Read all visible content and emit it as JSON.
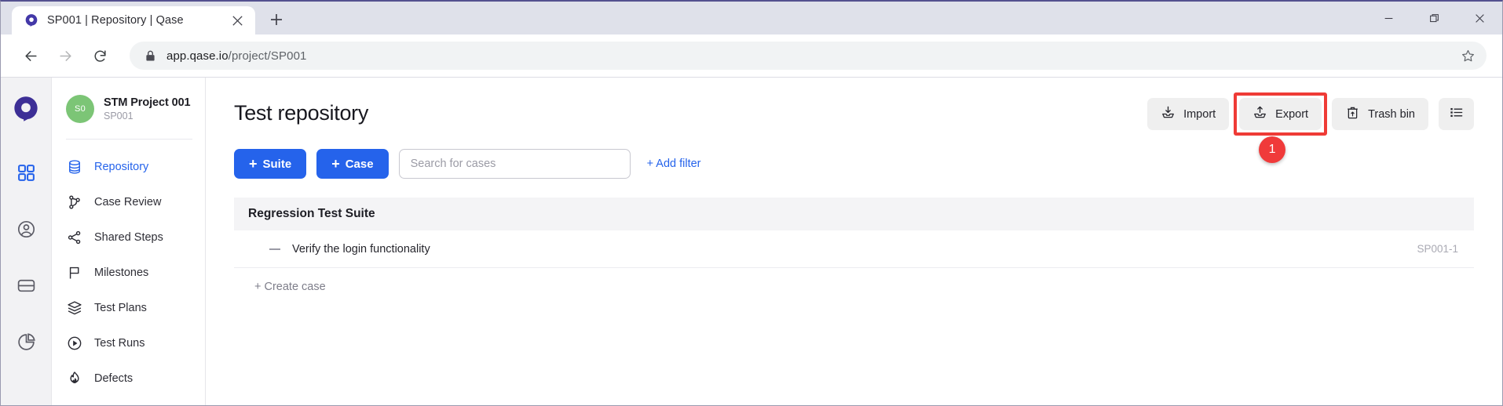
{
  "browser": {
    "tab": {
      "title": "SP001 | Repository | Qase",
      "favicon": "qase-logo-icon",
      "close": "close-icon"
    },
    "new_tab_label": "+",
    "window_controls": {
      "minimize": "minimize-icon",
      "maximize": "maximize-icon",
      "close": "close-icon"
    },
    "nav": {
      "back": "back-arrow-icon",
      "forward": "forward-arrow-icon",
      "reload": "reload-icon"
    },
    "address": {
      "lock": "lock-icon",
      "url_domain": "app.qase.io",
      "url_path": "/project/SP001",
      "full_url": "app.qase.io/project/SP001",
      "bookmark": "star-icon"
    }
  },
  "rail": {
    "logo": "qase-logo-icon",
    "items": [
      {
        "name": "apps-grid-icon",
        "active": true
      },
      {
        "name": "user-circle-icon",
        "active": false
      },
      {
        "name": "card-icon",
        "active": false
      },
      {
        "name": "pie-chart-icon",
        "active": false
      }
    ]
  },
  "sidebar": {
    "project": {
      "initials": "S0",
      "name": "STM Project 001",
      "code": "SP001"
    },
    "items": [
      {
        "label": "Repository",
        "icon": "database-icon",
        "active": true
      },
      {
        "label": "Case Review",
        "icon": "branch-icon",
        "active": false
      },
      {
        "label": "Shared Steps",
        "icon": "share-nodes-icon",
        "active": false
      },
      {
        "label": "Milestones",
        "icon": "flag-icon",
        "active": false
      },
      {
        "label": "Test Plans",
        "icon": "layers-icon",
        "active": false
      },
      {
        "label": "Test Runs",
        "icon": "play-circle-icon",
        "active": false
      },
      {
        "label": "Defects",
        "icon": "fire-icon",
        "active": false
      }
    ]
  },
  "main": {
    "title": "Test repository",
    "actions": {
      "import": {
        "label": "Import",
        "icon": "import-tray-icon"
      },
      "export": {
        "label": "Export",
        "icon": "export-tray-icon",
        "highlighted": true,
        "highlight_color": "#ef3b36"
      },
      "trash": {
        "label": "Trash bin",
        "icon": "trash-icon"
      },
      "list_view": {
        "label": "",
        "icon": "list-view-icon"
      }
    },
    "annotation": {
      "number": "1",
      "color": "#f03a3a"
    },
    "toolbar": {
      "add_suite": {
        "label": "Suite",
        "plus": "+"
      },
      "add_case": {
        "label": "Case",
        "plus": "+"
      },
      "search_placeholder": "Search for cases",
      "search_value": "",
      "add_filter": "+ Add filter"
    },
    "suites": [
      {
        "name": "Regression Test Suite",
        "cases": [
          {
            "title": "Verify the login functionality",
            "id": "SP001-1"
          }
        ]
      }
    ],
    "create_case": "+ Create case"
  },
  "colors": {
    "primary": "#2563eb",
    "brand_purple": "#4338a8",
    "avatar_green": "#7cc576",
    "accent_red": "#f03a3a"
  }
}
